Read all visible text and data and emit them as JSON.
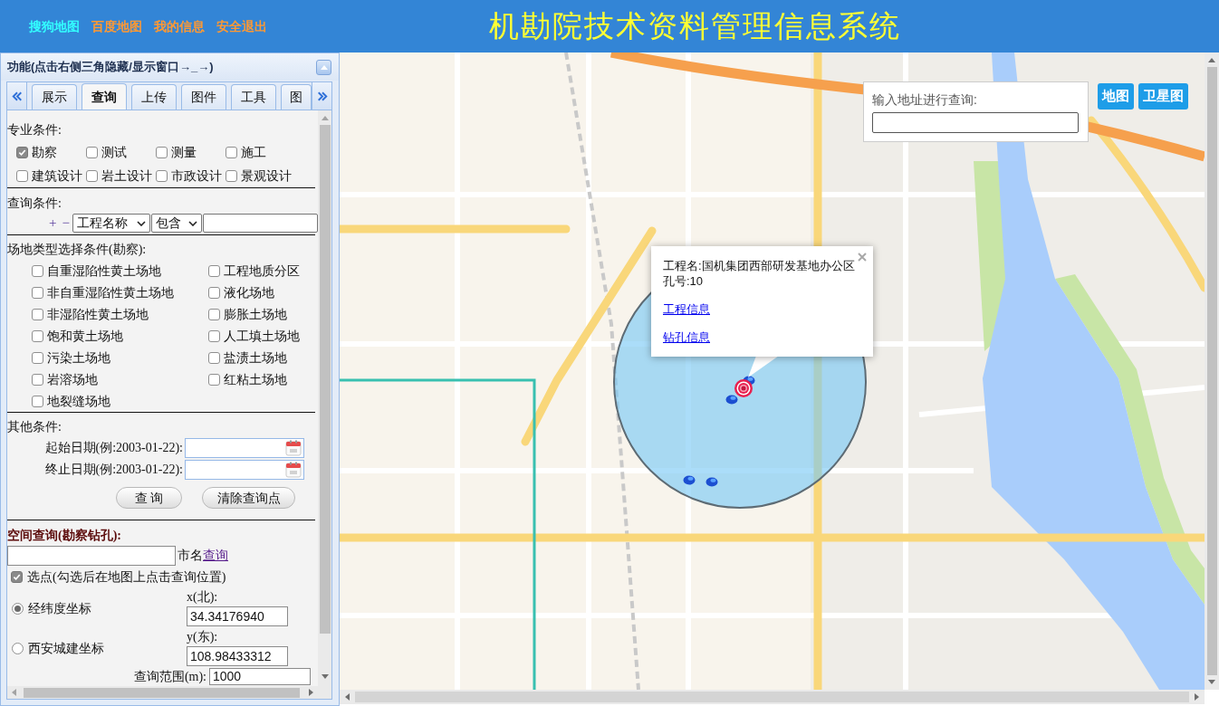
{
  "header": {
    "links": [
      {
        "label": "搜狗地图",
        "color": "#33ffff"
      },
      {
        "label": "百度地图",
        "color": "#ff9933"
      },
      {
        "label": "我的信息",
        "color": "#ff9933"
      },
      {
        "label": "安全退出",
        "color": "#ff9933"
      }
    ],
    "title": "机勘院技术资料管理信息系统"
  },
  "panel": {
    "title": "功能(点击右侧三角隐藏/显示窗口→_→)",
    "tabs": [
      {
        "label": "展示",
        "selected": false
      },
      {
        "label": "查询",
        "selected": true
      },
      {
        "label": "上传",
        "selected": false
      },
      {
        "label": "图件",
        "selected": false
      },
      {
        "label": "工具",
        "selected": false
      },
      {
        "label": "图",
        "selected": false
      }
    ],
    "professional": {
      "label": "专业条件:",
      "options": [
        {
          "label": "勘察",
          "checked": true
        },
        {
          "label": "测试",
          "checked": false
        },
        {
          "label": "测量",
          "checked": false
        },
        {
          "label": "施工",
          "checked": false
        },
        {
          "label": "建筑设计",
          "checked": false
        },
        {
          "label": "岩土设计",
          "checked": false
        },
        {
          "label": "市政设计",
          "checked": false
        },
        {
          "label": "景观设计",
          "checked": false
        }
      ]
    },
    "query": {
      "label": "查询条件:",
      "add": "+",
      "remove": "−",
      "field": "工程名称",
      "operator": "包含"
    },
    "site_types": {
      "label": "场地类型选择条件(勘察):",
      "options": [
        {
          "label": "自重湿陷性黄土场地",
          "checked": false
        },
        {
          "label": "工程地质分区",
          "checked": false
        },
        {
          "label": "非自重湿陷性黄土场地",
          "checked": false
        },
        {
          "label": "液化场地",
          "checked": false
        },
        {
          "label": "非湿陷性黄土场地",
          "checked": false
        },
        {
          "label": "膨胀土场地",
          "checked": false
        },
        {
          "label": "饱和黄土场地",
          "checked": false
        },
        {
          "label": "人工填土场地",
          "checked": false
        },
        {
          "label": "污染土场地",
          "checked": false
        },
        {
          "label": "盐渍土场地",
          "checked": false
        },
        {
          "label": "岩溶场地",
          "checked": false
        },
        {
          "label": "红粘土场地",
          "checked": false
        },
        {
          "label": "地裂缝场地",
          "checked": false
        }
      ]
    },
    "other": {
      "label": "其他条件:",
      "dates": [
        {
          "label": "起始日期(例:2003-01-22):"
        },
        {
          "label": "终止日期(例:2003-01-22):"
        }
      ],
      "buttons": [
        "查 询",
        "清除查询点"
      ]
    },
    "spatial": {
      "title": "空间查询(勘察钻孔):",
      "city_label": "市名",
      "city_link": "查询",
      "pick_point": {
        "label": "选点(勾选后在地图上点击查询位置)",
        "checked": true
      },
      "coord_systems": [
        {
          "label": "经纬度坐标",
          "selected": true
        },
        {
          "label": "西安城建坐标",
          "selected": false
        }
      ],
      "coords": [
        {
          "label": "x(北):",
          "value": "34.34176940"
        },
        {
          "label": "y(东):",
          "value": "108.98433312"
        }
      ],
      "range": {
        "label": "查询范围(m):",
        "value": "1000"
      }
    }
  },
  "map": {
    "search": {
      "label": "输入地址进行查询:"
    },
    "map_types": [
      "地图",
      "卫星图"
    ],
    "popup": {
      "lines": [
        "工程名:国机集团西部研发基地办公区",
        "孔号:10"
      ],
      "links": [
        "工程信息",
        "钻孔信息"
      ]
    }
  }
}
